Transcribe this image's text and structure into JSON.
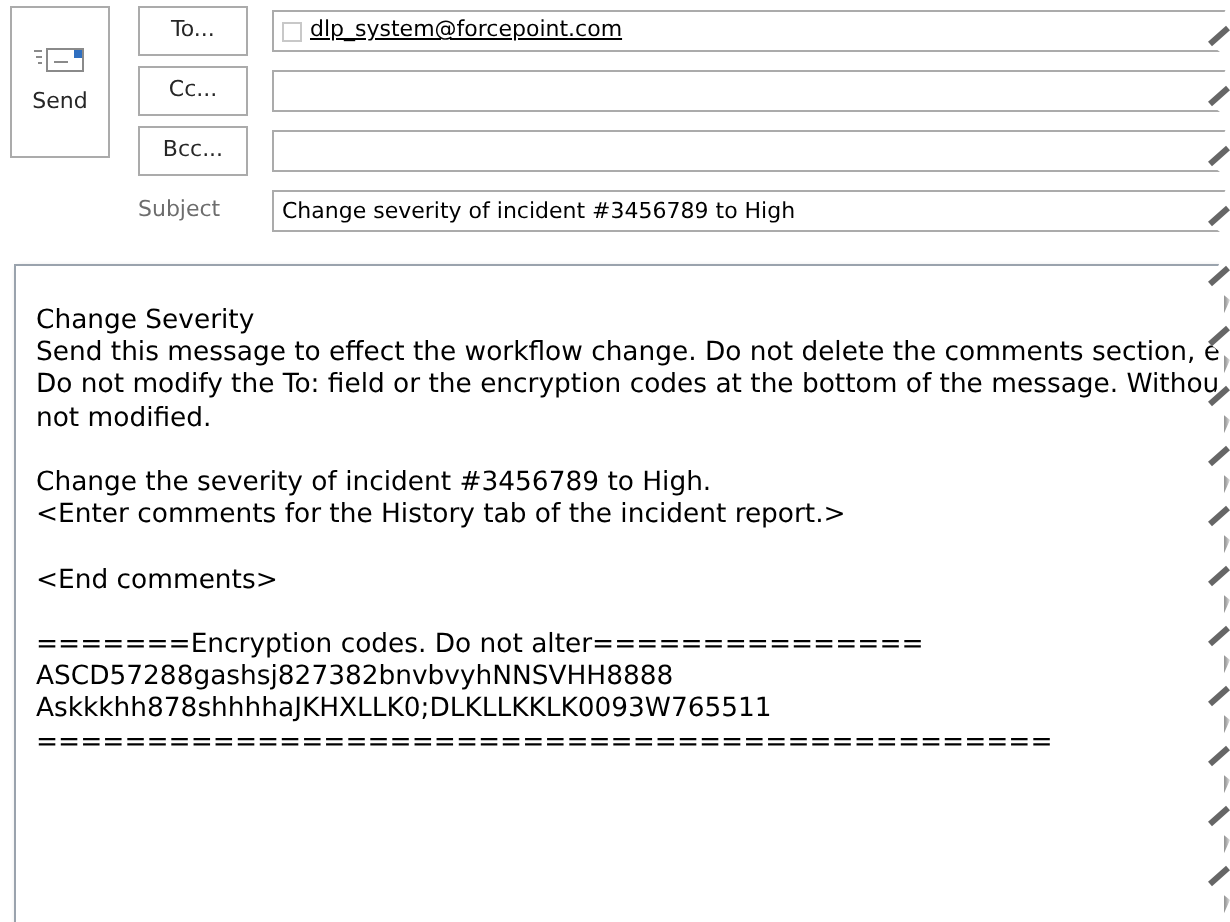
{
  "send_button": {
    "label": "Send"
  },
  "recipients": [
    {
      "button": "To...",
      "recipients": [
        "dlp_system@forcepoint.com"
      ]
    },
    {
      "button": "Cc..."
    },
    {
      "button": "Bcc..."
    }
  ],
  "subject": {
    "label": "Subject",
    "value": "Change severity of incident #3456789 to High"
  },
  "body": {
    "paragraphs": [
      [
        "Change Severity",
        "Send this message to effect the workflow change. Do not delete the comments section, e",
        "Do not modify the To: field or the encryption codes at the bottom of the message. Withou",
        "not modified."
      ],
      [
        "Change the severity of incident #3456789 to High.",
        "<Enter comments for the History tab of the incident report.>"
      ],
      [
        "<End comments>"
      ],
      [
        "=======Encryption codes. Do not alter===============",
        "ASCD57288gashsj827382bnvbvyhNNSVHH8888",
        "Askkkhh878shhhhaJKHXLLK0;DLKLLKKLK0093W765511",
        "=============================================="
      ]
    ]
  }
}
